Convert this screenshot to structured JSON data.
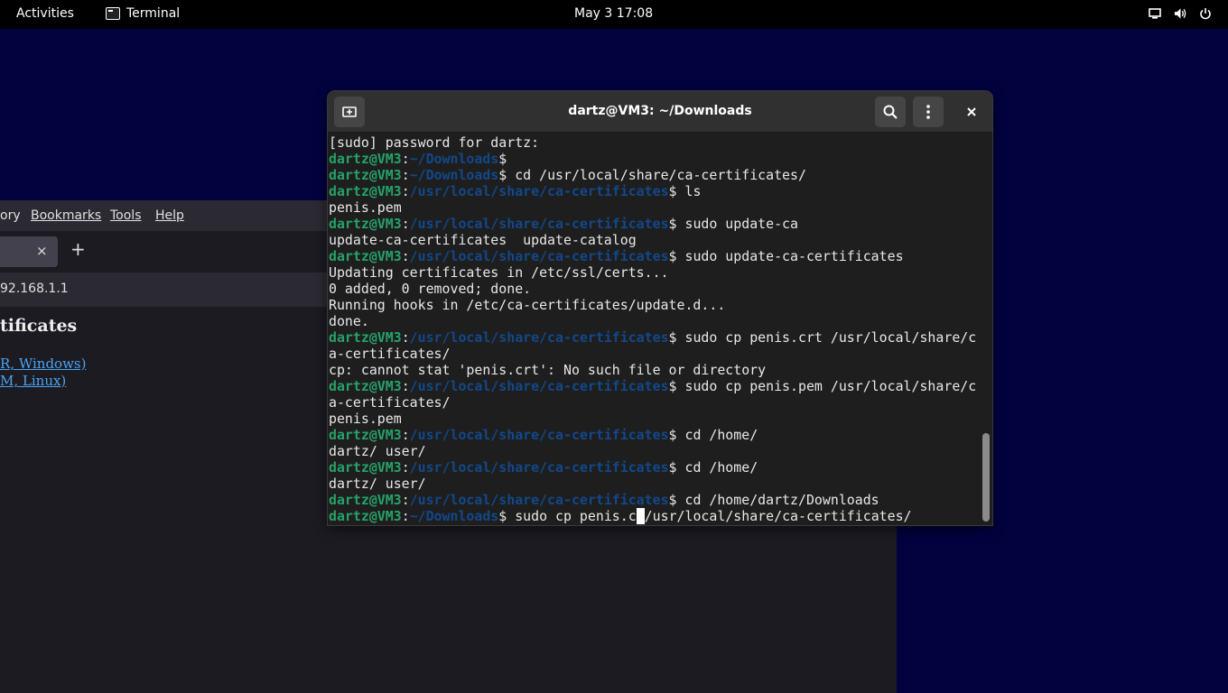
{
  "topbar": {
    "activities": "Activities",
    "app_name": "Terminal",
    "clock": "May 3  17:08",
    "icons": [
      "screen-icon",
      "volume-icon",
      "power-icon"
    ]
  },
  "browser": {
    "menu": [
      "ory",
      "Bookmarks",
      "Tools",
      "Help"
    ],
    "tab_close": "×",
    "new_tab": "+",
    "url": "92.168.1.1",
    "heading": "tificates",
    "links": [
      "R, Windows)",
      "M, Linux)"
    ]
  },
  "terminal": {
    "title": "dartz@VM3: ~/Downloads",
    "user": "dartz@VM3",
    "lines": [
      {
        "type": "out",
        "text": "[sudo] password for dartz:"
      },
      {
        "type": "prompt",
        "path": "~/Downloads",
        "cmd": ""
      },
      {
        "type": "prompt",
        "path": "~/Downloads",
        "cmd": " cd /usr/local/share/ca-certificates/"
      },
      {
        "type": "prompt",
        "path": "/usr/local/share/ca-certificates",
        "cmd": " ls"
      },
      {
        "type": "out",
        "text": "penis.pem"
      },
      {
        "type": "prompt",
        "path": "/usr/local/share/ca-certificates",
        "cmd": " sudo update-ca"
      },
      {
        "type": "out",
        "text": "update-ca-certificates  update-catalog"
      },
      {
        "type": "prompt",
        "path": "/usr/local/share/ca-certificates",
        "cmd": " sudo update-ca-certificates"
      },
      {
        "type": "out",
        "text": "Updating certificates in /etc/ssl/certs..."
      },
      {
        "type": "out",
        "text": "0 added, 0 removed; done."
      },
      {
        "type": "out",
        "text": "Running hooks in /etc/ca-certificates/update.d..."
      },
      {
        "type": "out",
        "text": "done."
      },
      {
        "type": "prompt",
        "path": "/usr/local/share/ca-certificates",
        "cmd": " sudo cp penis.crt /usr/local/share/c"
      },
      {
        "type": "out",
        "text": "a-certificates/"
      },
      {
        "type": "out",
        "text": "cp: cannot stat 'penis.crt': No such file or directory"
      },
      {
        "type": "prompt",
        "path": "/usr/local/share/ca-certificates",
        "cmd": " sudo cp penis.pem /usr/local/share/c"
      },
      {
        "type": "out",
        "text": "a-certificates/"
      },
      {
        "type": "out",
        "text": "penis.pem"
      },
      {
        "type": "prompt",
        "path": "/usr/local/share/ca-certificates",
        "cmd": " cd /home/"
      },
      {
        "type": "out",
        "text": "dartz/ user/"
      },
      {
        "type": "prompt",
        "path": "/usr/local/share/ca-certificates",
        "cmd": " cd /home/"
      },
      {
        "type": "out",
        "text": "dartz/ user/"
      },
      {
        "type": "prompt",
        "path": "/usr/local/share/ca-certificates",
        "cmd": " cd /home/dartz/Downloads"
      }
    ],
    "current": {
      "path": "~/Downloads",
      "before_cursor": " sudo cp penis.c",
      "under_cursor": " ",
      "after_cursor": "/usr/local/share/ca-certificates/"
    }
  },
  "colors": {
    "desktop": "#02023f",
    "prompt_user": "#26a269",
    "prompt_path": "#12488b",
    "terminal_bg": "#1e1e1e"
  }
}
